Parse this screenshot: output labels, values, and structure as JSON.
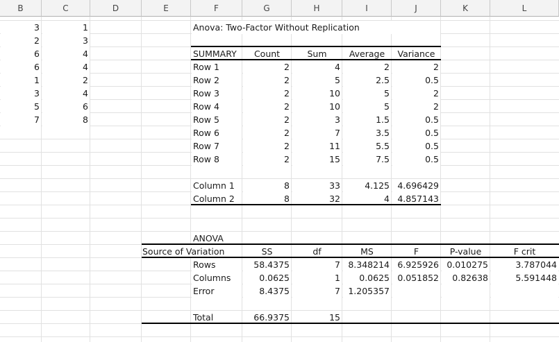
{
  "columns": [
    "B",
    "C",
    "D",
    "E",
    "F",
    "G",
    "H",
    "I",
    "J",
    "K",
    "L"
  ],
  "data_b": [
    "3",
    "2",
    "6",
    "6",
    "1",
    "3",
    "5",
    "7"
  ],
  "data_c": [
    "1",
    "3",
    "4",
    "4",
    "2",
    "4",
    "6",
    "8"
  ],
  "title": "Anova: Two-Factor Without Replication",
  "summary": {
    "headers": [
      "SUMMARY",
      "Count",
      "Sum",
      "Average",
      "Variance"
    ],
    "rows": [
      [
        "Row 1",
        "2",
        "4",
        "2",
        "2"
      ],
      [
        "Row 2",
        "2",
        "5",
        "2.5",
        "0.5"
      ],
      [
        "Row 3",
        "2",
        "10",
        "5",
        "2"
      ],
      [
        "Row 4",
        "2",
        "10",
        "5",
        "2"
      ],
      [
        "Row 5",
        "2",
        "3",
        "1.5",
        "0.5"
      ],
      [
        "Row 6",
        "2",
        "7",
        "3.5",
        "0.5"
      ],
      [
        "Row 7",
        "2",
        "11",
        "5.5",
        "0.5"
      ],
      [
        "Row 8",
        "2",
        "15",
        "7.5",
        "0.5"
      ]
    ],
    "cols": [
      [
        "Column 1",
        "8",
        "33",
        "4.125",
        "4.696429"
      ],
      [
        "Column 2",
        "8",
        "32",
        "4",
        "4.857143"
      ]
    ]
  },
  "anova": {
    "label": "ANOVA",
    "headers": [
      "Source of Variation",
      "SS",
      "df",
      "MS",
      "F",
      "P-value",
      "F crit"
    ],
    "rows": [
      [
        "Rows",
        "58.4375",
        "7",
        "8.348214",
        "6.925926",
        "0.010275",
        "3.787044"
      ],
      [
        "Columns",
        "0.0625",
        "1",
        "0.0625",
        "0.051852",
        "0.82638",
        "5.591448"
      ],
      [
        "Error",
        "8.4375",
        "7",
        "1.205357",
        "",
        "",
        ""
      ]
    ],
    "total": [
      "Total",
      "66.9375",
      "15",
      "",
      "",
      "",
      ""
    ]
  }
}
